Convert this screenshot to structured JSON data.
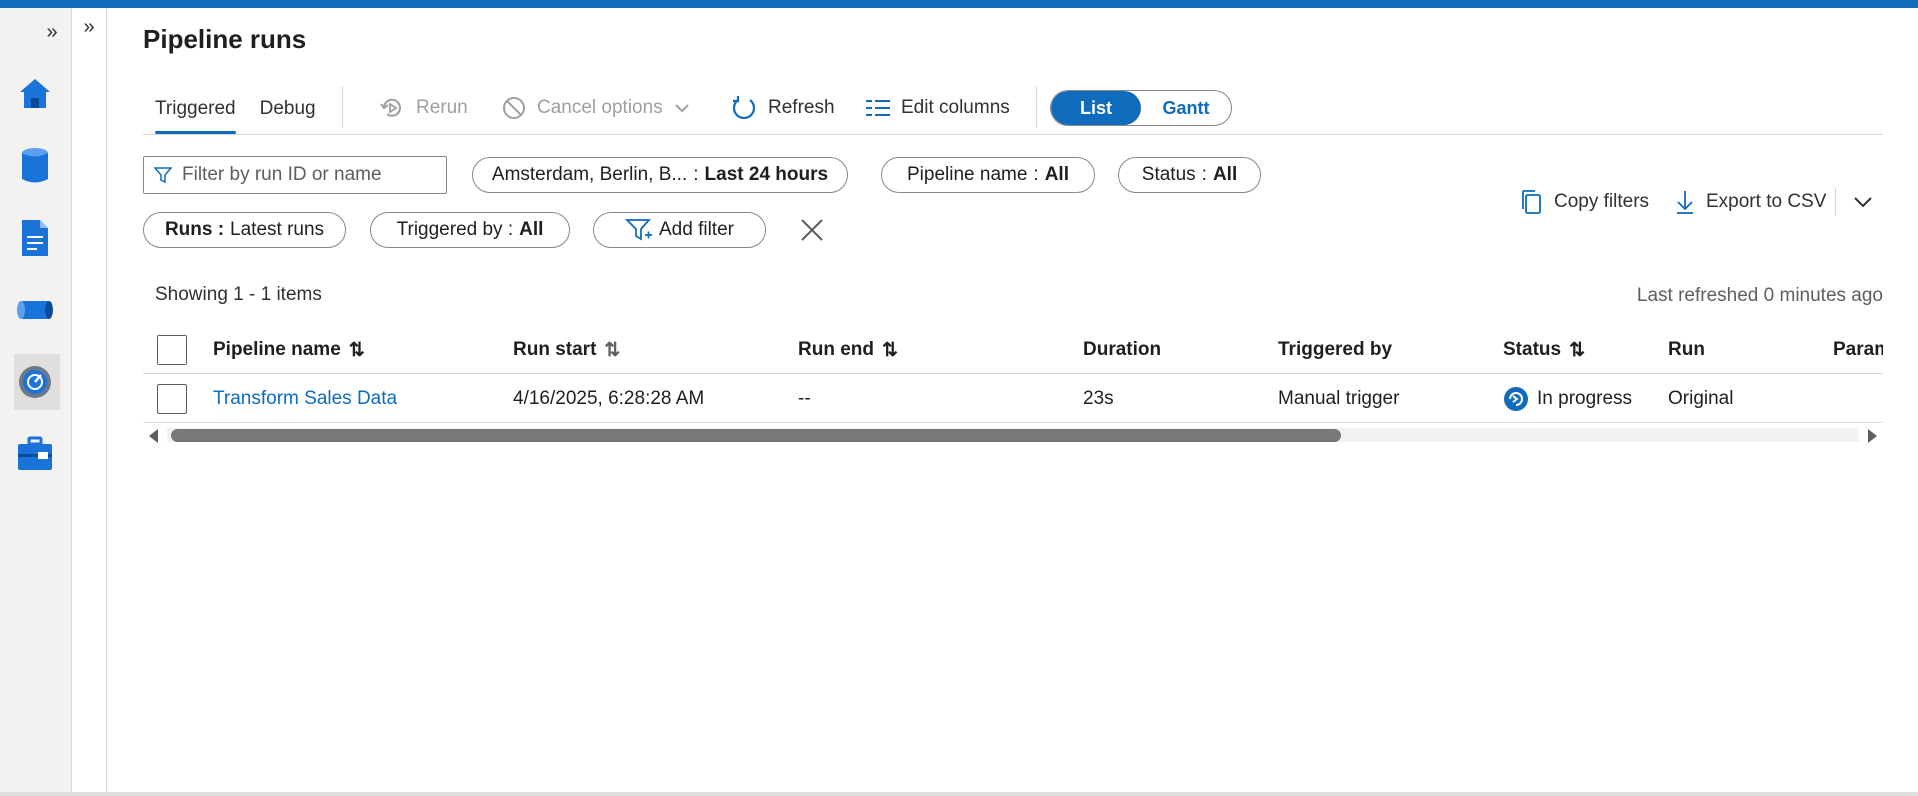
{
  "leftrail": {
    "expand_icon": "double-chevron-right-icon",
    "items": [
      {
        "name": "home",
        "icon": "home-icon"
      },
      {
        "name": "data",
        "icon": "database-icon"
      },
      {
        "name": "author",
        "icon": "document-icon"
      },
      {
        "name": "pipeline",
        "icon": "pipeline-icon"
      },
      {
        "name": "monitor",
        "icon": "monitor-gauge-icon",
        "active": true
      },
      {
        "name": "manage",
        "icon": "toolbox-icon"
      }
    ]
  },
  "page": {
    "title": "Pipeline runs"
  },
  "tabs": [
    {
      "label": "Triggered",
      "active": true
    },
    {
      "label": "Debug",
      "active": false
    }
  ],
  "toolbar": {
    "rerun_label": "Rerun",
    "cancel_label": "Cancel options",
    "refresh_label": "Refresh",
    "edit_columns_label": "Edit columns",
    "view_toggle": {
      "list": "List",
      "gantt": "Gantt",
      "selected": "List"
    }
  },
  "filters": {
    "search_placeholder": "Filter by run ID or name",
    "timezone_label": "Amsterdam, Berlin, B...",
    "timezone_value": "Last 24 hours",
    "pipeline_name_label": "Pipeline name",
    "pipeline_name_value": "All",
    "status_label": "Status",
    "status_value": "All",
    "runs_label": "Runs :",
    "runs_value": "Latest runs",
    "triggered_by_label": "Triggered by :",
    "triggered_by_value": "All",
    "add_filter_label": "Add filter"
  },
  "actions": {
    "copy_filters": "Copy filters",
    "export_csv": "Export to CSV"
  },
  "summary": {
    "showing": "Showing 1 - 1 items",
    "last_refreshed": "Last refreshed 0 minutes ago"
  },
  "grid": {
    "columns": [
      "Pipeline name",
      "Run start",
      "Run end",
      "Duration",
      "Triggered by",
      "Status",
      "Run",
      "Param"
    ],
    "rows": [
      {
        "pipeline_name": "Transform Sales Data",
        "run_start": "4/16/2025, 6:28:28 AM",
        "run_end": "--",
        "duration": "23s",
        "triggered_by": "Manual trigger",
        "status": "In progress",
        "run": "Original"
      }
    ]
  },
  "colors": {
    "accent": "#0f6cbd",
    "text": "#201f1e",
    "muted": "#605e5c",
    "disabled": "#a19f9d"
  }
}
